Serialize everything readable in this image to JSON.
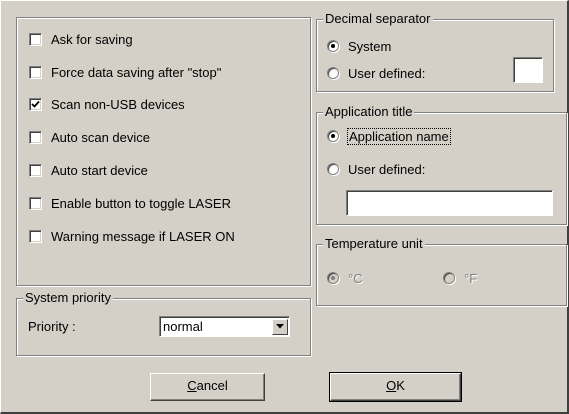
{
  "options": {
    "checkboxes": [
      {
        "label": "Ask for saving",
        "checked": false
      },
      {
        "label": "Force data saving after \"stop\"",
        "checked": false
      },
      {
        "label": "Scan non-USB devices",
        "checked": true
      },
      {
        "label": "Auto scan device",
        "checked": false
      },
      {
        "label": "Auto start device",
        "checked": false
      },
      {
        "label": "Enable button to toggle LASER",
        "checked": false
      },
      {
        "label": "Warning message if LASER ON",
        "checked": false
      }
    ]
  },
  "system_priority": {
    "title": "System priority",
    "priority_label": "Priority :",
    "priority_value": "normal"
  },
  "decimal_separator": {
    "title": "Decimal separator",
    "system_label": "System",
    "user_defined_label": "User defined:",
    "selected": "system",
    "user_value": ""
  },
  "application_title": {
    "title": "Application title",
    "app_name_label": "Application name",
    "user_defined_label": "User defined:",
    "selected": "app_name",
    "user_value": ""
  },
  "temperature_unit": {
    "title": "Temperature unit",
    "celsius_label": "°C",
    "fahrenheit_label": "°F",
    "selected": "celsius",
    "enabled": false
  },
  "buttons": {
    "cancel_label": "Cancel",
    "cancel_mnemonic": "C",
    "cancel_rest": "ancel",
    "ok_label": "OK",
    "ok_mnemonic": "O",
    "ok_rest": "K"
  }
}
